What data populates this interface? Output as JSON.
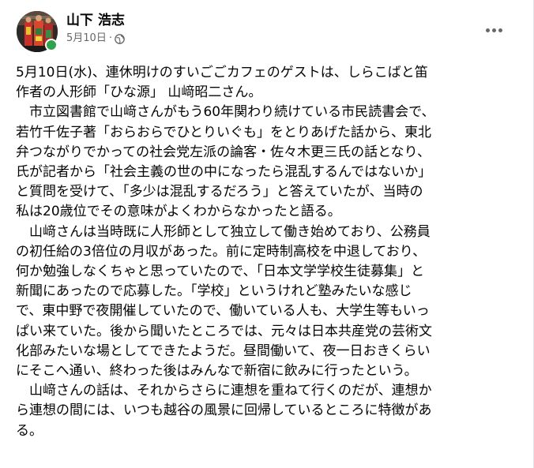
{
  "post": {
    "author": "山下 浩志",
    "date": "5月10日",
    "separator": "·",
    "privacy_icon": "globe-icon",
    "more_icon": "more-horizontal-icon",
    "online_status_color": "#31a24c",
    "paragraphs": [
      "5月10日(水)、連休明けのすいごごカフェのゲストは、しらこばと笛\n作者の人形師「ひな源」 山﨑昭二さん。",
      "　市立図書館で山﨑さんがもう60年関わり続けている市民読書会で、\n若竹千佐子著「おらおらでひとりいぐも」をとりあげた話から、東北\n弁つながりでかっての社会党左派の論客・佐々木更三氏の話となり、\n氏が記者から「社会主義の世の中になったら混乱するんではないか」\nと質問を受けて、「多少は混乱するだろう」と答えていたが、当時の\n私は20歳位でその意味がよくわからなかったと語る。",
      "　山﨑さんは当時既に人形師として独立して働き始めており、公務員\nの初任給の3倍位の月収があった。前に定時制高校を中退しており、\n何か勉強しなくちゃと思っていたので、「日本文学学校生徒募集」と\n新聞にあったので応募した。「学校」というけれど塾みたいな感じ\nで、東中野で夜開催していたので、働いている人も、大学生等もいっ\nぱい来ていた。後から聞いたところでは、元々は日本共産党の芸術文\n化部みたいな場としてできたようだ。昼間働いて、夜一日おきくらい\nにそこへ通い、終わった後はみんなで新宿に飲みに行ったという。",
      "　山﨑さんの話は、それからさらに連想を重ねて行くのだが、連想か\nら連想の間には、いつも越谷の風景に回帰しているところに特徴があ\nる。"
    ]
  }
}
